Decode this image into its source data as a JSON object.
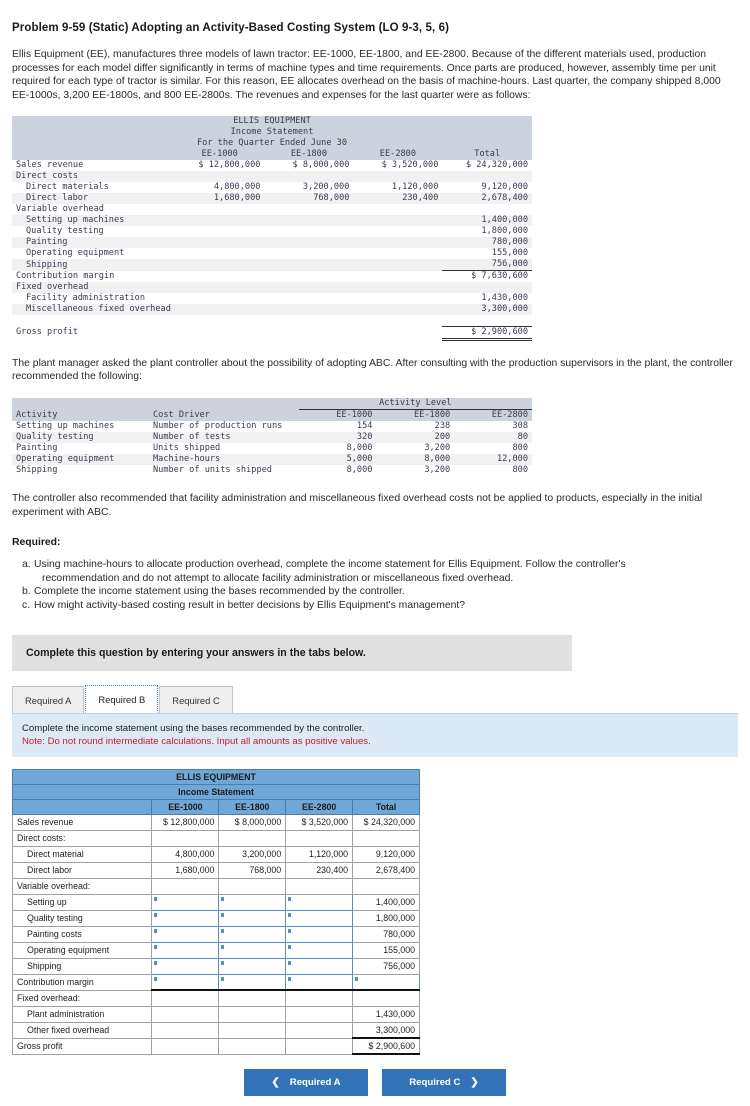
{
  "problem": {
    "title": "Problem 9-59 (Static) Adopting an Activity-Based Costing System (LO 9-3, 5, 6)",
    "intro": "Ellis Equipment (EE), manufactures three models of lawn tractor: EE-1000, EE-1800, and EE-2800. Because of the different materials used, production processes for each model differ significantly in terms of machine types and time requirements. Once parts are produced, however, assembly time per unit required for each type of tractor is similar. For this reason, EE allocates overhead on the basis of machine-hours. Last quarter, the company shipped 8,000 EE-1000s, 3,200 EE-1800s, and 800 EE-2800s. The revenues and expenses for the last quarter were as follows:",
    "para_after_is": "The plant manager asked the plant controller about the possibility of adopting ABC. After consulting with the production supervisors in the plant, the controller recommended the following:",
    "para_after_activity": "The controller also recommended that facility administration and miscellaneous fixed overhead costs not be applied to products, especially in the initial experiment with ABC.",
    "required_heading": "Required:",
    "required_items": [
      {
        "letter": "a.",
        "text": "Using machine-hours to allocate production overhead, complete the income statement for Ellis Equipment. Follow the controller's",
        "cont": "recommendation and do not attempt to allocate facility administration or miscellaneous fixed overhead."
      },
      {
        "letter": "b.",
        "text": "Complete the income statement using the bases recommended by the controller.",
        "cont": ""
      },
      {
        "letter": "c.",
        "text": "How might activity-based costing result in better decisions by Ellis Equipment's management?",
        "cont": ""
      }
    ]
  },
  "income_statement": {
    "company": "ELLIS EQUIPMENT",
    "statement": "Income Statement",
    "period": "For the Quarter Ended June 30",
    "columns": [
      "EE-1000",
      "EE-1800",
      "EE-2800",
      "Total"
    ],
    "rows": [
      {
        "label": "Sales revenue",
        "indent": 0,
        "values": [
          "$ 12,800,000",
          "$ 8,000,000",
          "$ 3,520,000",
          "$ 24,320,000"
        ]
      },
      {
        "label": "Direct costs",
        "indent": 0,
        "values": [
          "",
          "",
          "",
          ""
        ]
      },
      {
        "label": "Direct materials",
        "indent": 1,
        "values": [
          "4,800,000",
          "3,200,000",
          "1,120,000",
          "9,120,000"
        ]
      },
      {
        "label": "Direct labor",
        "indent": 1,
        "values": [
          "1,680,000",
          "768,000",
          "230,400",
          "2,678,400"
        ]
      },
      {
        "label": "Variable overhead",
        "indent": 0,
        "values": [
          "",
          "",
          "",
          ""
        ]
      },
      {
        "label": "Setting up machines",
        "indent": 1,
        "values": [
          "",
          "",
          "",
          "1,400,000"
        ]
      },
      {
        "label": "Quality testing",
        "indent": 1,
        "values": [
          "",
          "",
          "",
          "1,800,000"
        ]
      },
      {
        "label": "Painting",
        "indent": 1,
        "values": [
          "",
          "",
          "",
          "780,000"
        ]
      },
      {
        "label": "Operating equipment",
        "indent": 1,
        "values": [
          "",
          "",
          "",
          "155,000"
        ]
      },
      {
        "label": "Shipping",
        "indent": 1,
        "values": [
          "",
          "",
          "",
          "756,000"
        ]
      },
      {
        "label": "Contribution margin",
        "indent": 0,
        "values": [
          "",
          "",
          "",
          "$ 7,630,600"
        ]
      },
      {
        "label": "Fixed overhead",
        "indent": 0,
        "values": [
          "",
          "",
          "",
          ""
        ]
      },
      {
        "label": "Facility administration",
        "indent": 1,
        "values": [
          "",
          "",
          "",
          "1,430,000"
        ]
      },
      {
        "label": "Miscellaneous fixed overhead",
        "indent": 1,
        "values": [
          "",
          "",
          "",
          "3,300,000"
        ]
      },
      {
        "label": "Gross profit",
        "indent": 0,
        "values": [
          "",
          "",
          "",
          "$ 2,900,600"
        ]
      }
    ]
  },
  "activity_table": {
    "group_header": "Activity Level",
    "columns": [
      "Activity",
      "Cost Driver",
      "EE-1000",
      "EE-1800",
      "EE-2800"
    ],
    "rows": [
      {
        "activity": "Setting up machines",
        "driver": "Number of production runs",
        "v": [
          "154",
          "238",
          "308"
        ]
      },
      {
        "activity": "Quality testing",
        "driver": "Number of tests",
        "v": [
          "320",
          "200",
          "80"
        ]
      },
      {
        "activity": "Painting",
        "driver": "Units shipped",
        "v": [
          "8,000",
          "3,200",
          "800"
        ]
      },
      {
        "activity": "Operating equipment",
        "driver": "Machine-hours",
        "v": [
          "5,000",
          "8,000",
          "12,000"
        ]
      },
      {
        "activity": "Shipping",
        "driver": "Number of units shipped",
        "v": [
          "8,000",
          "3,200",
          "800"
        ]
      }
    ]
  },
  "answer_panel": {
    "gray_bar": "Complete this question by entering your answers in the tabs below.",
    "tabs": [
      {
        "label": "Required A",
        "active": false
      },
      {
        "label": "Required B",
        "active": true
      },
      {
        "label": "Required C",
        "active": false
      }
    ],
    "note_line1": "Complete the income statement using the bases recommended by the controller.",
    "note_line2": "Note: Do not round intermediate calculations. Input all amounts as positive values.",
    "table": {
      "company": "ELLIS EQUIPMENT",
      "statement": "Income Statement",
      "columns": [
        "EE-1000",
        "EE-1800",
        "EE-2800",
        "Total"
      ],
      "rows": [
        {
          "label": "Sales revenue",
          "indent": 0,
          "cells": [
            "$  12,800,000",
            "$   8,000,000",
            "$   3,520,000",
            "$  24,320,000"
          ],
          "input": [
            false,
            false,
            false,
            false
          ]
        },
        {
          "label": "Direct costs:",
          "indent": 0,
          "cells": [
            "",
            "",
            "",
            ""
          ],
          "input": [
            false,
            false,
            false,
            false
          ]
        },
        {
          "label": "Direct material",
          "indent": 1,
          "cells": [
            "4,800,000",
            "3,200,000",
            "1,120,000",
            "9,120,000"
          ],
          "input": [
            false,
            false,
            false,
            false
          ]
        },
        {
          "label": "Direct labor",
          "indent": 1,
          "cells": [
            "1,680,000",
            "768,000",
            "230,400",
            "2,678,400"
          ],
          "input": [
            false,
            false,
            false,
            false
          ]
        },
        {
          "label": "Variable overhead:",
          "indent": 0,
          "cells": [
            "",
            "",
            "",
            ""
          ],
          "input": [
            false,
            false,
            false,
            false
          ]
        },
        {
          "label": "Setting up",
          "indent": 1,
          "cells": [
            "",
            "",
            "",
            "1,400,000"
          ],
          "input": [
            true,
            true,
            true,
            false
          ]
        },
        {
          "label": "Quality testing",
          "indent": 1,
          "cells": [
            "",
            "",
            "",
            "1,800,000"
          ],
          "input": [
            true,
            true,
            true,
            false
          ]
        },
        {
          "label": "Painting costs",
          "indent": 1,
          "cells": [
            "",
            "",
            "",
            "780,000"
          ],
          "input": [
            true,
            true,
            true,
            false
          ]
        },
        {
          "label": "Operating equipment",
          "indent": 1,
          "cells": [
            "",
            "",
            "",
            "155,000"
          ],
          "input": [
            true,
            true,
            true,
            false
          ]
        },
        {
          "label": "Shipping",
          "indent": 1,
          "cells": [
            "",
            "",
            "",
            "756,000"
          ],
          "input": [
            true,
            true,
            true,
            false
          ]
        },
        {
          "label": "Contribution margin",
          "indent": 0,
          "cells": [
            "",
            "",
            "",
            ""
          ],
          "input": [
            true,
            true,
            true,
            true
          ]
        },
        {
          "label": "Fixed overhead:",
          "indent": 0,
          "cells": [
            "",
            "",
            "",
            ""
          ],
          "input": [
            false,
            false,
            false,
            false
          ]
        },
        {
          "label": "Plant administration",
          "indent": 1,
          "cells": [
            "",
            "",
            "",
            "1,430,000"
          ],
          "input": [
            false,
            false,
            false,
            false
          ]
        },
        {
          "label": "Other fixed overhead",
          "indent": 1,
          "cells": [
            "",
            "",
            "",
            "3,300,000"
          ],
          "input": [
            false,
            false,
            false,
            false
          ]
        },
        {
          "label": "Gross profit",
          "indent": 0,
          "cells": [
            "",
            "",
            "",
            "$    2,900,600"
          ],
          "input": [
            false,
            false,
            false,
            false
          ]
        }
      ]
    },
    "nav": {
      "prev_label": "Required A",
      "next_label": "Required C",
      "prev_icon": "chevron-left-icon",
      "next_icon": "chevron-right-icon"
    }
  },
  "colors": {
    "accent_blue": "#3273b8",
    "table_header_blue": "#6fa8d8",
    "note_band": "#dceaf6",
    "note_red": "#c21b2c",
    "gray_bar": "#e0e0e0",
    "mono_band": "#ccd3de"
  }
}
